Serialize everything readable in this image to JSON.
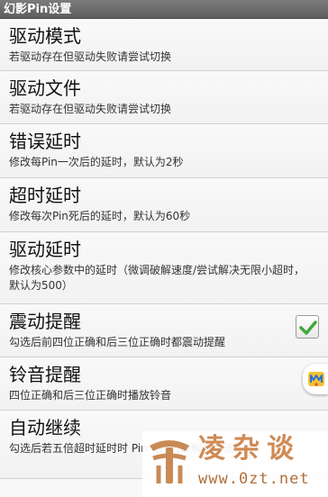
{
  "window": {
    "title": "幻影Pin设置"
  },
  "settings": [
    {
      "title": "驱动模式",
      "summary": "若驱动存在但驱动失败请尝试切换"
    },
    {
      "title": "驱动文件",
      "summary": "若驱动存在但驱动失败请尝试切换"
    },
    {
      "title": "错误延时",
      "summary": "修改每Pin一次后的延时，默认为2秒"
    },
    {
      "title": "超时延时",
      "summary": "修改每次Pin死后的延时，默认为60秒"
    },
    {
      "title": "驱动延时",
      "summary": "修改核心参数中的延时（微调破解速度/尝试解决无限小超时，默认为500）"
    },
    {
      "title": "震动提醒",
      "summary": "勾选后前四位正确和后三位正确时都震动提醒",
      "checked": true
    },
    {
      "title": "铃音提醒",
      "summary": "四位正确和后三位正确时播放铃音"
    },
    {
      "title": "自动继续",
      "summary": "勾选后若五倍超时延时时 Pin（挂机破解可勾选）"
    }
  ],
  "icons": {
    "checkbox_check": "check-icon",
    "floating": "floating-assistant-icon",
    "watermark_logo": "watermark-logo-icon"
  },
  "watermark": {
    "name": "凌杂谈",
    "url": "www.0zt.net"
  },
  "colors": {
    "titlebar": "#6b6b6b",
    "check": "#3fa93a",
    "watermark": "#cf8a55"
  }
}
